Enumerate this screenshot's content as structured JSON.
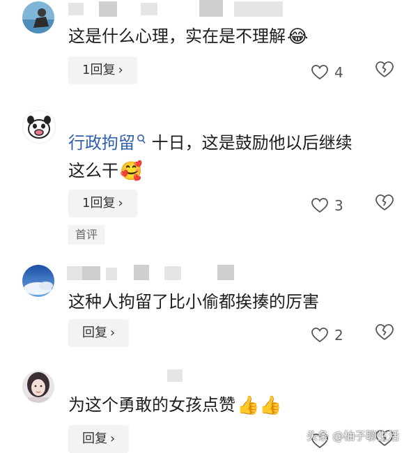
{
  "comments": [
    {
      "text": "这是什么心理，实在是不理解",
      "emoji": "😂",
      "reply_label": "1回复",
      "likes": "4"
    },
    {
      "mention": "行政拘留",
      "mention_icon": "search-icon",
      "text_line1": " 十日，这是鼓励他以后继续",
      "text_line2": "这么干",
      "emoji": "🥰",
      "reply_label": "1回复",
      "likes": "3",
      "tag": "首评"
    },
    {
      "text": "这种人拘留了比小偷都挨揍的厉害",
      "reply_label": "回复",
      "likes": "2"
    },
    {
      "text": "为这个勇敢的女孩点赞",
      "emoji": "👍👍",
      "reply_label": "回复"
    }
  ],
  "chevron": "›",
  "watermark": "头条 @柚子聊生活",
  "colors": {
    "mention": "#2f5fb0",
    "button_bg": "#f3f3f3"
  }
}
